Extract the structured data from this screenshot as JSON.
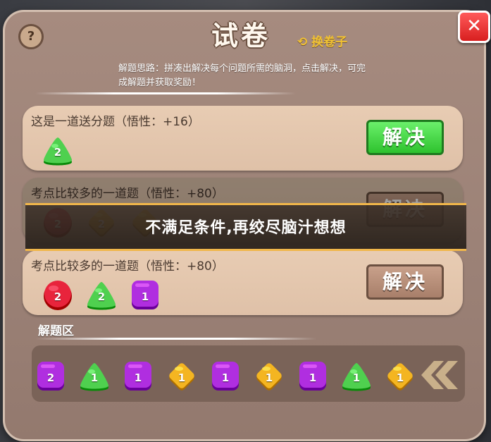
{
  "header": {
    "title": "试卷",
    "switch_label": "换卷子",
    "help_label": "?",
    "close_label": "✕"
  },
  "hint": "解题思路：拼凑出解决每个问题所需的脑洞，点击解决，可完成解题并获取奖励！",
  "questions": [
    {
      "text": "这是一道送分题（悟性：+16）",
      "button": "解决",
      "enabled": true,
      "gems": [
        {
          "shape": "triangle",
          "color": "green",
          "value": "2"
        }
      ]
    },
    {
      "text": "考点比较多的一道题（悟性：+80）",
      "button": "解决",
      "enabled": false,
      "gems": [
        {
          "shape": "circle",
          "color": "red",
          "value": "2"
        },
        {
          "shape": "diamond",
          "color": "yellow",
          "value": "2"
        },
        {
          "shape": "diamond",
          "color": "yellow",
          "value": ""
        }
      ]
    },
    {
      "text": "考点比较多的一道题（悟性：+80）",
      "button": "解决",
      "enabled": true,
      "gems": [
        {
          "shape": "circle",
          "color": "red",
          "value": "2"
        },
        {
          "shape": "triangle",
          "color": "green",
          "value": "2"
        },
        {
          "shape": "square",
          "color": "purple",
          "value": "1"
        }
      ]
    }
  ],
  "toast": "不满足条件,再绞尽脑汁想想",
  "solve_area": {
    "label": "解题区",
    "gems": [
      {
        "shape": "square",
        "color": "purple",
        "value": "2"
      },
      {
        "shape": "triangle",
        "color": "green",
        "value": "1"
      },
      {
        "shape": "square",
        "color": "purple",
        "value": "1"
      },
      {
        "shape": "diamond",
        "color": "yellow",
        "value": "1"
      },
      {
        "shape": "square",
        "color": "purple",
        "value": "1"
      },
      {
        "shape": "diamond",
        "color": "yellow",
        "value": "1"
      },
      {
        "shape": "square",
        "color": "purple",
        "value": "1"
      },
      {
        "shape": "triangle",
        "color": "green",
        "value": "1"
      },
      {
        "shape": "diamond",
        "color": "yellow",
        "value": "1"
      }
    ]
  },
  "colors": {
    "green": "#4fd04f",
    "red": "#e8243c",
    "yellow": "#f4b521",
    "purple": "#b02ee0"
  },
  "icons": {
    "switch": "refresh-icon",
    "close": "close-icon",
    "help": "help-icon",
    "scroll": "double-chevron-left-icon"
  }
}
